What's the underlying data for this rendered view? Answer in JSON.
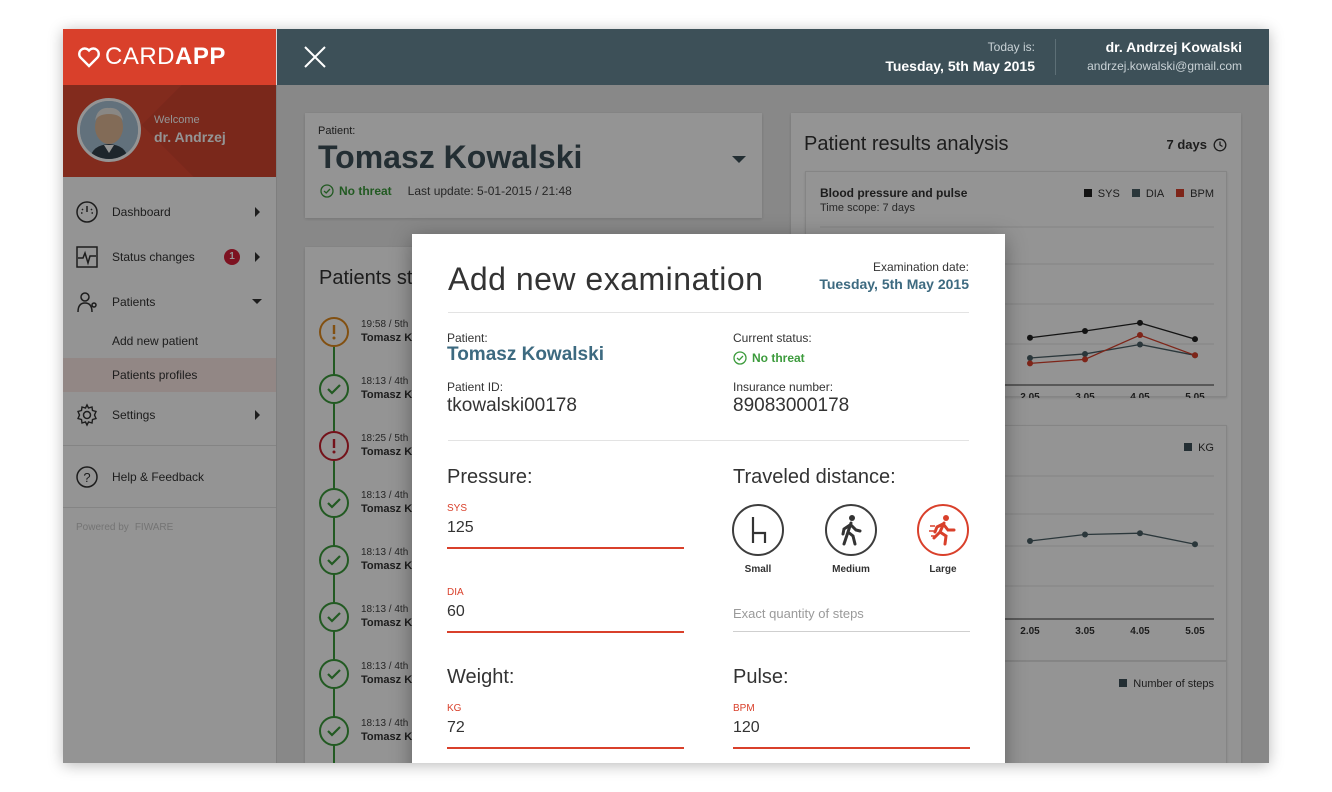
{
  "app": {
    "logo_light": "CARD",
    "logo_bold": "APP"
  },
  "sidebar": {
    "welcome_label": "Welcome",
    "welcome_name": "dr. Andrzej",
    "items": [
      {
        "label": "Dashboard",
        "icon": "dashboard-icon"
      },
      {
        "label": "Status changes",
        "icon": "pulse-icon",
        "badge": "1"
      },
      {
        "label": "Patients",
        "icon": "stethoscope-icon"
      },
      {
        "label": "Settings",
        "icon": "gear-icon"
      },
      {
        "label": "Help & Feedback",
        "icon": "help-icon"
      }
    ],
    "sub_items": [
      "Add new patient",
      "Patients profiles"
    ],
    "powered_by": "Powered by",
    "powered_brand": "FIWARE"
  },
  "header": {
    "today_label": "Today is:",
    "today_value": "Tuesday, 5th May 2015",
    "user_name": "dr. Andrzej Kowalski",
    "user_email": "andrzej.kowalski@gmail.com"
  },
  "patient_card": {
    "label": "Patient:",
    "name": "Tomasz Kowalski",
    "status": "No threat",
    "last_update": "Last update: 5-01-2015 / 21:48"
  },
  "timeline": {
    "title": "Patients st",
    "items": [
      {
        "time": "19:58 / 5th",
        "name": "Tomasz K",
        "status": "warning"
      },
      {
        "time": "18:13 / 4th",
        "name": "Tomasz K",
        "status": "ok"
      },
      {
        "time": "18:25 / 5th",
        "name": "Tomasz K",
        "status": "danger"
      },
      {
        "time": "18:13 / 4th",
        "name": "Tomasz K",
        "status": "ok"
      },
      {
        "time": "18:13 / 4th",
        "name": "Tomasz K",
        "status": "ok"
      },
      {
        "time": "18:13 / 4th",
        "name": "Tomasz K",
        "status": "ok"
      },
      {
        "time": "18:13 / 4th",
        "name": "Tomasz K",
        "status": "ok"
      },
      {
        "time": "18:13 / 4th",
        "name": "Tomasz K",
        "status": "ok"
      }
    ]
  },
  "analysis": {
    "title": "Patient results analysis",
    "range": "7 days",
    "chart1_title": "Blood pressure and pulse",
    "chart1_scope": "Time scope: 7 days",
    "legend": {
      "sys": "SYS",
      "dia": "DIA",
      "bpm": "BPM",
      "kg": "KG",
      "steps": "Number of steps"
    },
    "colors": {
      "sys": "#222222",
      "dia": "#4a5f66",
      "bpm": "#d9402b"
    }
  },
  "chart_data": [
    {
      "type": "line",
      "title": "Blood pressure and pulse",
      "categories": [
        "2.05",
        "3.05",
        "4.05",
        "5.05"
      ],
      "series": [
        {
          "name": "SYS",
          "values": [
            135,
            140,
            146,
            134
          ]
        },
        {
          "name": "DIA",
          "values": [
            120,
            123,
            130,
            122
          ]
        },
        {
          "name": "BPM",
          "values": [
            116,
            119,
            137,
            122
          ]
        }
      ]
    },
    {
      "type": "line",
      "categories": [
        "2.05",
        "3.05",
        "4.05",
        "5.05"
      ],
      "series": [
        {
          "name": "KG",
          "values": [
            72,
            73,
            73.2,
            71.5
          ]
        }
      ]
    }
  ],
  "modal": {
    "title": "Add new examination",
    "exam_date_label": "Examination date:",
    "exam_date_value": "Tuesday, 5th May 2015",
    "patient_label": "Patient:",
    "patient_name": "Tomasz Kowalski",
    "status_label": "Current status:",
    "status_value": "No threat",
    "pid_label": "Patient ID:",
    "pid_value": "tkowalski00178",
    "ins_label": "Insurance number:",
    "ins_value": "89083000178",
    "pressure_title": "Pressure:",
    "sys_label": "SYS",
    "sys_value": "125",
    "dia_label": "DIA",
    "dia_value": "60",
    "distance_title": "Traveled distance:",
    "dist_options": [
      "Small",
      "Medium",
      "Large"
    ],
    "dist_selected": "Large",
    "steps_placeholder": "Exact quantity of steps",
    "weight_title": "Weight:",
    "kg_label": "KG",
    "kg_value": "72",
    "pulse_title": "Pulse:",
    "bpm_label": "BPM",
    "bpm_value": "120"
  }
}
